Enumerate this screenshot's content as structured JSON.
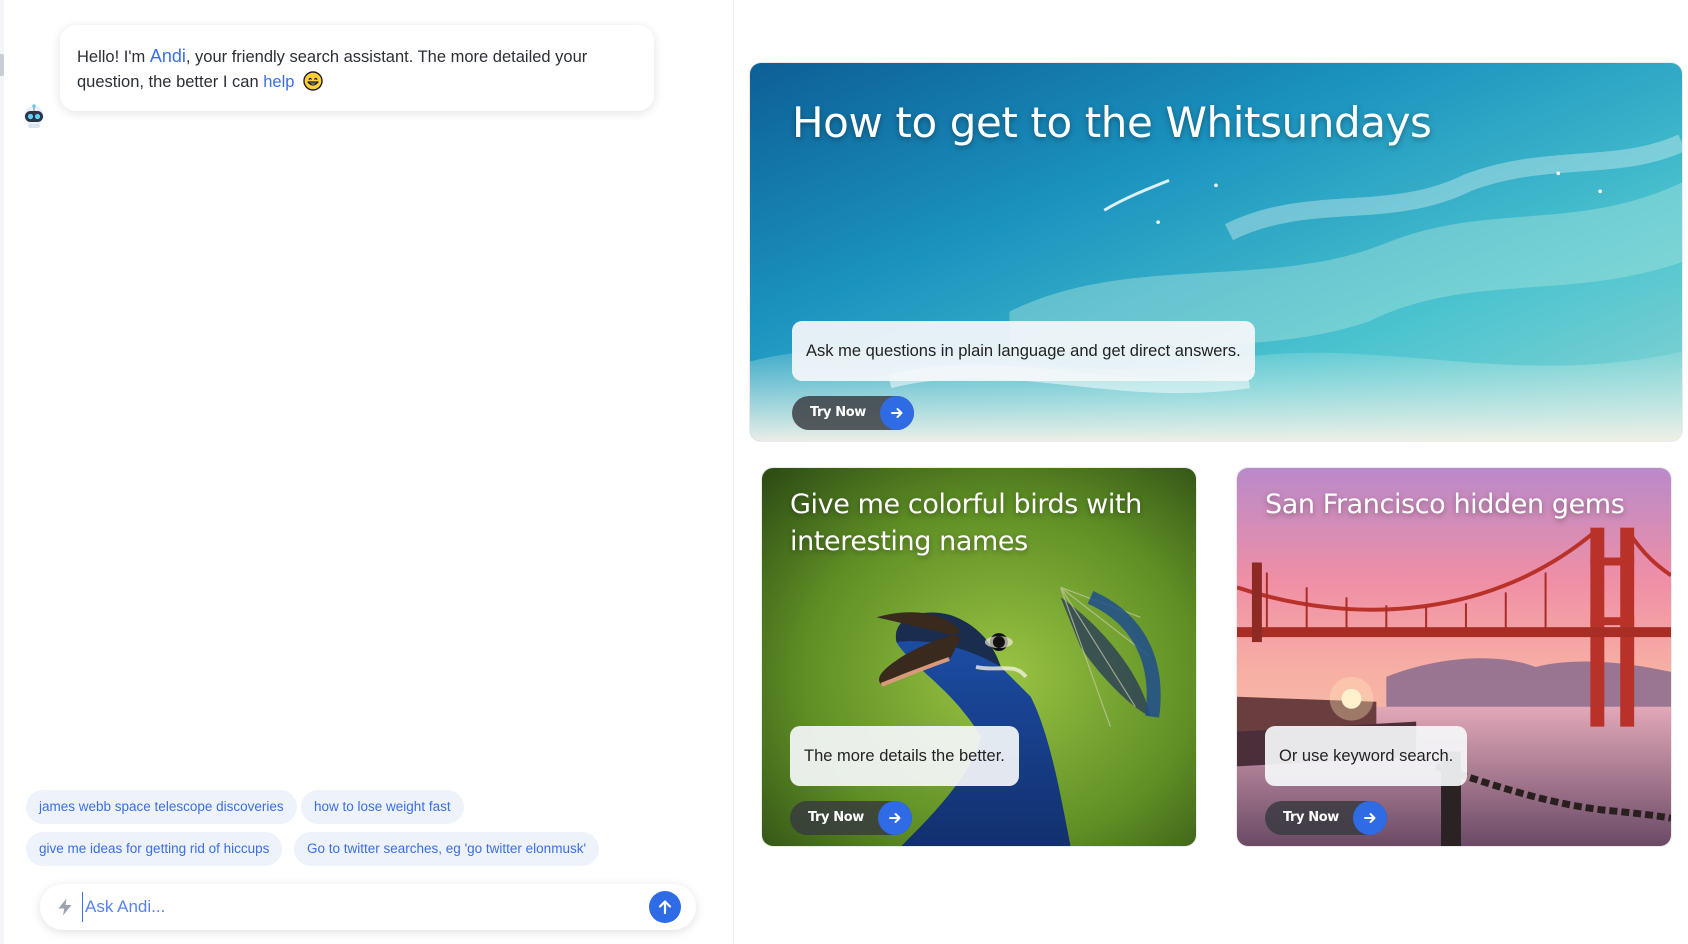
{
  "chat": {
    "assistant_name": "Andi",
    "greeting_prefix": "Hello! I'm ",
    "greeting_middle": ", your friendly search assistant. The more detailed your question, the better I can ",
    "greeting_link": "help",
    "greeting_emoji": "grinning-face-emoji",
    "suggestions": [
      "james webb space telescope discoveries",
      "how to lose weight fast",
      "give me ideas for getting rid of hiccups",
      "Go to twitter searches, eg 'go twitter elonmusk'"
    ],
    "input_placeholder": "Ask Andi...",
    "input_icon": "bolt-icon",
    "send_icon": "arrow-up-icon"
  },
  "cards": [
    {
      "title": "How to get to the Whitsundays",
      "caption": "Ask me questions in plain language and get direct answers.",
      "button_label": "Try Now",
      "image": "aerial-beach-swirls"
    },
    {
      "title": "Give me colorful birds with interesting names",
      "caption": "The more details the better.",
      "button_label": "Try Now",
      "image": "peacock-head"
    },
    {
      "title": "San Francisco hidden gems",
      "caption": "Or use keyword search.",
      "button_label": "Try Now",
      "image": "golden-gate-bridge-sunset"
    }
  ],
  "colors": {
    "accent": "#2f6be4",
    "link": "#3b6fe4",
    "chip_bg": "#eef2fb"
  }
}
